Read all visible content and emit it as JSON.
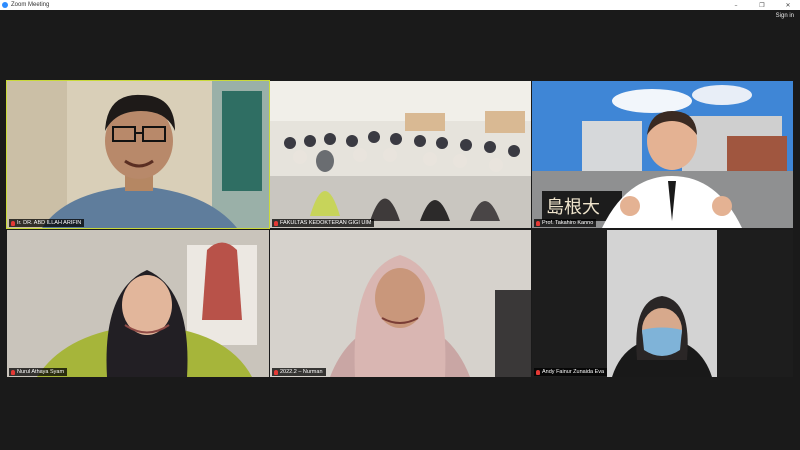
{
  "window": {
    "title": "Zoom Meeting",
    "minimize": "–",
    "maximize": "❐",
    "close": "✕"
  },
  "header": {
    "sign_in": "Sign in"
  },
  "participants": [
    {
      "name": "Ir. DR. ABD ILLAH ARIFIN",
      "active": true
    },
    {
      "name": "FAKULTAS KEDOKTERAN GIGI UIM"
    },
    {
      "name": "Prof. Takahiro Kanno"
    },
    {
      "name": "Nurul Athaya Syam"
    },
    {
      "name": "2022.2 – Nurman"
    },
    {
      "name": "Andy Fainur Zunaida Eva"
    }
  ],
  "signage": {
    "kanji": "島根大"
  }
}
